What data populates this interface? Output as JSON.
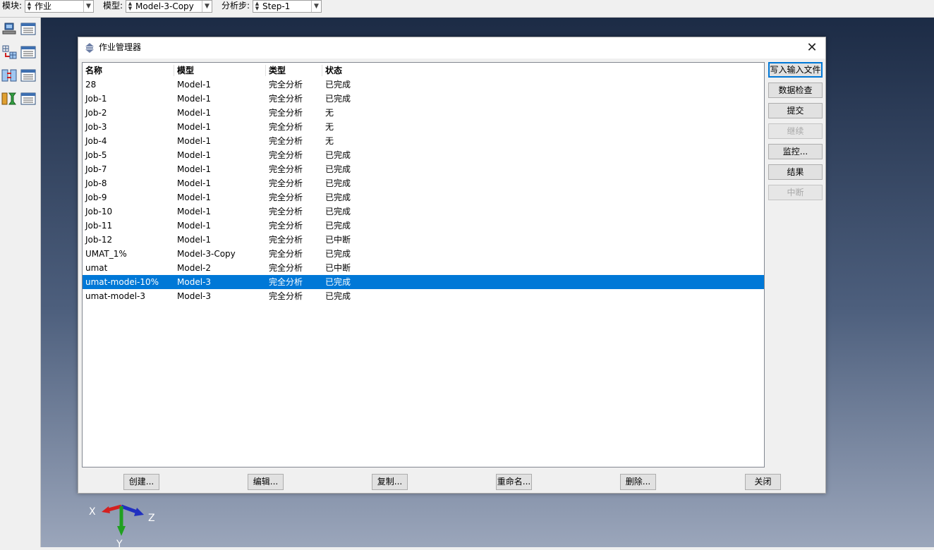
{
  "context_bar": {
    "module_label": "模块:",
    "module_value": "作业",
    "model_label": "模型:",
    "model_value": "Model-3-Copy",
    "step_label": "分析步:",
    "step_value": "Step-1"
  },
  "toolbox": {
    "icons": [
      "job-submit-icon",
      "job-manager-icon",
      "adaptivity-icon",
      "adaptivity-manager-icon",
      "coupled-analysis-icon",
      "coupled-manager-icon",
      "optimization-icon",
      "optimization-manager-icon"
    ]
  },
  "viewport": {
    "triad": {
      "x": "X",
      "y": "Y",
      "z": "Z"
    },
    "colors": {
      "x_axis": "#d42020",
      "y_axis": "#20a020",
      "z_axis": "#2030c0"
    }
  },
  "dialog": {
    "title": "作业管理器",
    "columns": {
      "name": "名称",
      "model": "模型",
      "type": "类型",
      "status": "状态"
    },
    "jobs": [
      {
        "name": "28",
        "model": "Model-1",
        "type": "完全分析",
        "status": "已完成"
      },
      {
        "name": "Job-1",
        "model": "Model-1",
        "type": "完全分析",
        "status": "已完成"
      },
      {
        "name": "Job-2",
        "model": "Model-1",
        "type": "完全分析",
        "status": "无"
      },
      {
        "name": "Job-3",
        "model": "Model-1",
        "type": "完全分析",
        "status": "无"
      },
      {
        "name": "Job-4",
        "model": "Model-1",
        "type": "完全分析",
        "status": "无"
      },
      {
        "name": "Job-5",
        "model": "Model-1",
        "type": "完全分析",
        "status": "已完成"
      },
      {
        "name": "Job-7",
        "model": "Model-1",
        "type": "完全分析",
        "status": "已完成"
      },
      {
        "name": "Job-8",
        "model": "Model-1",
        "type": "完全分析",
        "status": "已完成"
      },
      {
        "name": "Job-9",
        "model": "Model-1",
        "type": "完全分析",
        "status": "已完成"
      },
      {
        "name": "Job-10",
        "model": "Model-1",
        "type": "完全分析",
        "status": "已完成"
      },
      {
        "name": "Job-11",
        "model": "Model-1",
        "type": "完全分析",
        "status": "已完成"
      },
      {
        "name": "Job-12",
        "model": "Model-1",
        "type": "完全分析",
        "status": "已中断"
      },
      {
        "name": "UMAT_1%",
        "model": "Model-3-Copy",
        "type": "完全分析",
        "status": "已完成"
      },
      {
        "name": "umat",
        "model": "Model-2",
        "type": "完全分析",
        "status": "已中断"
      },
      {
        "name": "umat-modei-10%",
        "model": "Model-3",
        "type": "完全分析",
        "status": "已完成",
        "selected": true
      },
      {
        "name": "umat-model-3",
        "model": "Model-3",
        "type": "完全分析",
        "status": "已完成"
      }
    ],
    "side_buttons": {
      "write_input": "写入输入文件",
      "data_check": "数据检查",
      "submit": "提交",
      "continue": "继续",
      "monitor": "监控...",
      "results": "结果",
      "kill": "中断"
    },
    "bottom_buttons": {
      "create": "创建...",
      "edit": "编辑...",
      "copy": "复制...",
      "rename": "重命名...",
      "delete": "删除...",
      "dismiss": "关闭"
    },
    "selection_color": "#0078d7"
  }
}
